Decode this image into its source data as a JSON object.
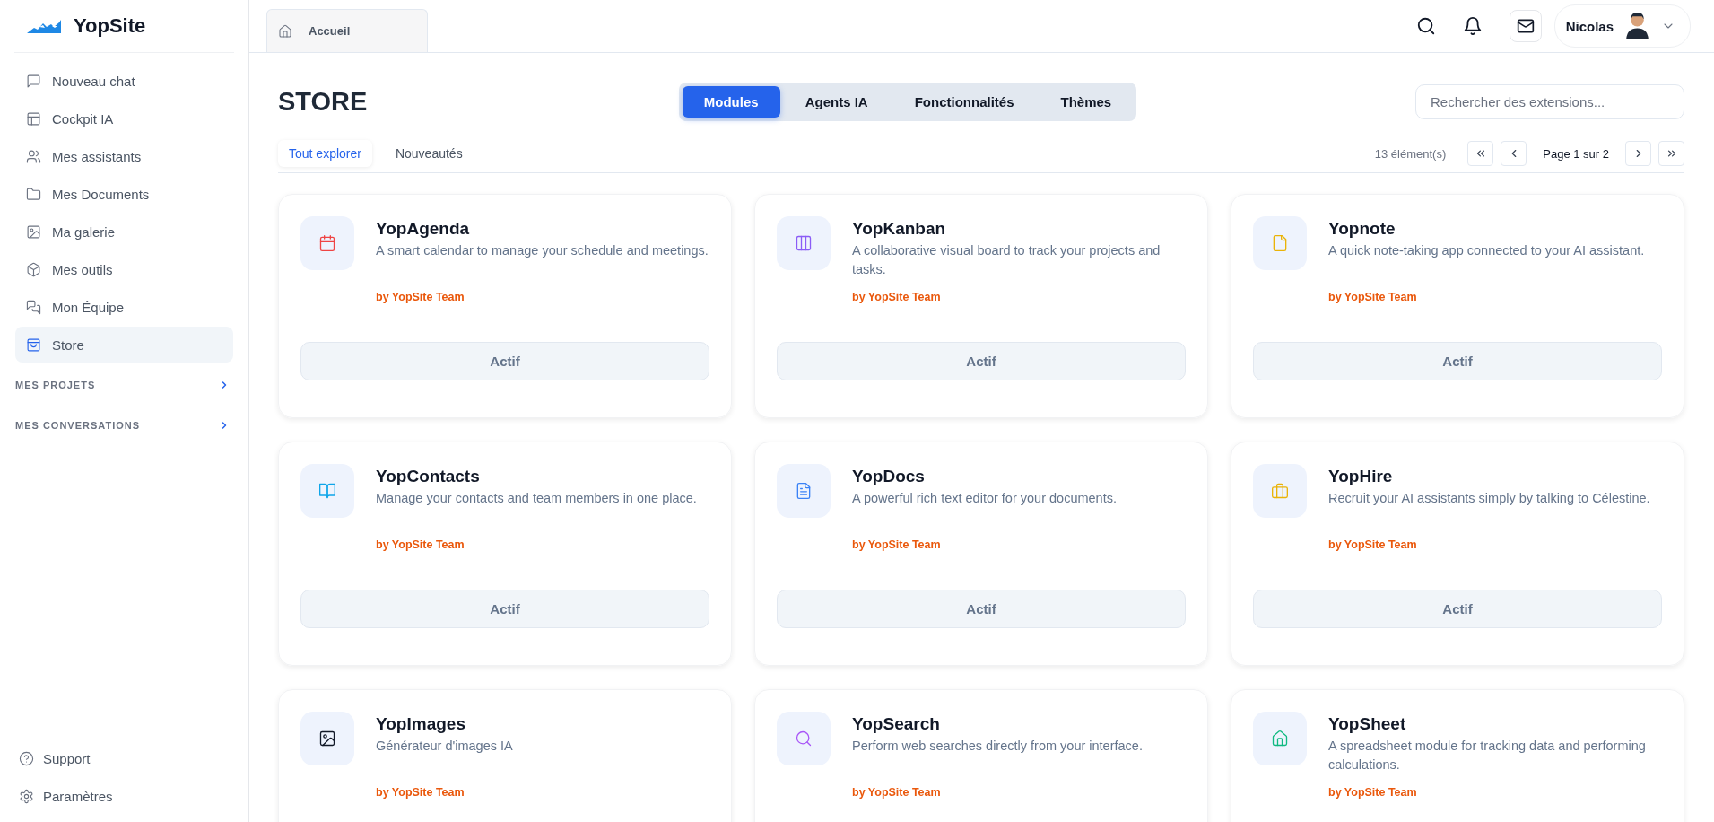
{
  "brand": {
    "name": "YopSite"
  },
  "sidebar": {
    "items": [
      {
        "label": "Nouveau chat",
        "kind": "chat",
        "selected": false
      },
      {
        "label": "Cockpit IA",
        "kind": "layout",
        "selected": false
      },
      {
        "label": "Mes assistants",
        "kind": "users",
        "selected": false
      },
      {
        "label": "Mes Documents",
        "kind": "folder",
        "selected": false
      },
      {
        "label": "Ma galerie",
        "kind": "image",
        "selected": false
      },
      {
        "label": "Mes outils",
        "kind": "box",
        "selected": false
      },
      {
        "label": "Mon Équipe",
        "kind": "team",
        "selected": false
      },
      {
        "label": "Store",
        "kind": "bag",
        "selected": true
      }
    ],
    "sections": [
      "MES PROJETS",
      "MES CONVERSATIONS"
    ],
    "footer": [
      {
        "label": "Support",
        "kind": "help"
      },
      {
        "label": "Paramètres",
        "kind": "gear"
      }
    ]
  },
  "top_tab": {
    "label": "Accueil"
  },
  "user": {
    "name": "Nicolas"
  },
  "page": {
    "title": "STORE",
    "categories": [
      {
        "label": "Modules",
        "selected": true
      },
      {
        "label": "Agents IA",
        "selected": false
      },
      {
        "label": "Fonctionnalités",
        "selected": false
      },
      {
        "label": "Thèmes",
        "selected": false
      }
    ],
    "search": {
      "placeholder": "Rechercher des extensions..."
    },
    "filters": [
      {
        "label": "Tout explorer",
        "selected": true
      },
      {
        "label": "Nouveautés",
        "selected": false
      }
    ],
    "count": "13 élément(s)",
    "pagination": "Page 1 sur 2"
  },
  "cards": [
    {
      "name": "YopAgenda",
      "description": "A smart calendar to manage your schedule and meetings.",
      "author": "by YopSite Team",
      "button": "Actif",
      "kind": "calendar",
      "color": "#ef4444"
    },
    {
      "name": "YopKanban",
      "description": "A collaborative visual board to track your projects and tasks.",
      "author": "by YopSite Team",
      "button": "Actif",
      "kind": "columns",
      "color": "#8b5cf6"
    },
    {
      "name": "Yopnote",
      "description": "A quick note-taking app connected to your AI assistant.",
      "author": "by YopSite Team",
      "button": "Actif",
      "kind": "file",
      "color": "#eab308"
    },
    {
      "name": "YopContacts",
      "description": "Manage your contacts and team members in one place.",
      "author": "by YopSite Team",
      "button": "Actif",
      "kind": "book",
      "color": "#0ea5e9"
    },
    {
      "name": "YopDocs",
      "description": "A powerful rich text editor for your documents.",
      "author": "by YopSite Team",
      "button": "Actif",
      "kind": "doc",
      "color": "#3b82f6"
    },
    {
      "name": "YopHire",
      "description": "Recruit your AI assistants simply by talking to Célestine.",
      "author": "by YopSite Team",
      "button": "Actif",
      "kind": "briefcase",
      "color": "#eab308"
    },
    {
      "name": "YopImages",
      "description": "Générateur d'images IA",
      "author": "by YopSite Team",
      "kind": "image",
      "color": "#111827"
    },
    {
      "name": "YopSearch",
      "description": "Perform web searches directly from your interface.",
      "author": "by YopSite Team",
      "kind": "search",
      "color": "#a855f7"
    },
    {
      "name": "YopSheet",
      "description": "A spreadsheet module for tracking data and performing calculations.",
      "author": "by YopSite Team",
      "kind": "home",
      "color": "#10b981"
    }
  ]
}
